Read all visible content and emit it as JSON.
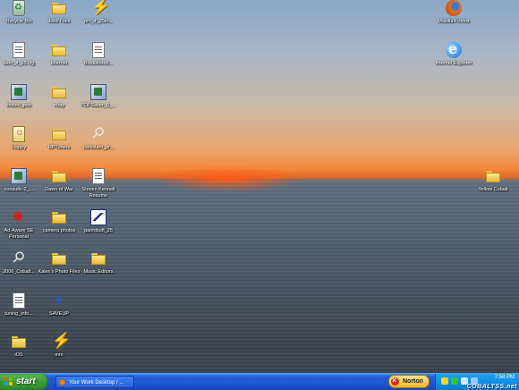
{
  "desktop": {
    "icons": [
      {
        "name": "recycle-bin-icon",
        "glyph": "bin",
        "label": "Recycle Bin",
        "col": 0,
        "row": 0
      },
      {
        "name": "folder-icon",
        "glyph": "folder",
        "label": "Jobs Files",
        "col": 1,
        "row": 0
      },
      {
        "name": "lightning-icon",
        "glyph": "bolt",
        "label": "pm_4_25in...",
        "col": 2,
        "row": 0
      },
      {
        "name": "document-icon",
        "glyph": "doc",
        "label": "dam_4_25.cfg",
        "col": 0,
        "row": 1
      },
      {
        "name": "folder-icon",
        "glyph": "folder",
        "label": "Internet",
        "col": 1,
        "row": 1
      },
      {
        "name": "document-icon",
        "glyph": "doc",
        "label": "Bookstore8...",
        "col": 2,
        "row": 1
      },
      {
        "name": "setup-icon",
        "glyph": "setup",
        "label": "limited_pos",
        "col": 0,
        "row": 2
      },
      {
        "name": "folder-icon",
        "glyph": "folder",
        "label": "ebay",
        "col": 1,
        "row": 2
      },
      {
        "name": "setup-icon",
        "glyph": "setup",
        "label": "PDFSaver_0_...",
        "col": 2,
        "row": 2
      },
      {
        "name": "happy-document-icon",
        "glyph": "happy",
        "label": "Happy",
        "col": 0,
        "row": 3
      },
      {
        "name": "folder-icon",
        "glyph": "folder",
        "label": "HPTuners",
        "col": 1,
        "row": 3
      },
      {
        "name": "wrench-icon",
        "glyph": "wrench2",
        "label": "darkslant_pr...",
        "col": 2,
        "row": 3
      },
      {
        "name": "setup-icon",
        "glyph": "setup",
        "label": "consultc-2_...",
        "col": 0,
        "row": 4
      },
      {
        "name": "folder-icon",
        "glyph": "folder",
        "label": "Dawn of War",
        "col": 1,
        "row": 4
      },
      {
        "name": "resume-document-icon",
        "glyph": "doc",
        "label": "Steven Kennell Resume",
        "col": 2,
        "row": 4
      },
      {
        "name": "ad-aware-icon",
        "glyph": "spider",
        "label": "Ad-Aware SE Personal",
        "col": 0,
        "row": 5
      },
      {
        "name": "folder-icon",
        "glyph": "folder",
        "label": "camera photos",
        "col": 1,
        "row": 5
      },
      {
        "name": "chart-icon",
        "glyph": "chart",
        "label": "panhlboft_25",
        "col": 2,
        "row": 5
      },
      {
        "name": "wrench-icon",
        "glyph": "wrench2",
        "label": "2006_Cobalt...",
        "col": 0,
        "row": 6
      },
      {
        "name": "folder-icon",
        "glyph": "folder",
        "label": "Kalen's Photo Files",
        "col": 1,
        "row": 6
      },
      {
        "name": "folder-icon",
        "glyph": "folder",
        "label": "Music Editors",
        "col": 2,
        "row": 6
      },
      {
        "name": "document-icon",
        "glyph": "doc",
        "label": "tuning_info...",
        "col": 0,
        "row": 7
      },
      {
        "name": "wizard-icon",
        "glyph": "wizard",
        "label": "SAVEUP",
        "col": 1,
        "row": 7
      },
      {
        "name": "folder-icon",
        "glyph": "folder",
        "label": "iOS",
        "col": 0,
        "row": 8
      },
      {
        "name": "lightning-icon",
        "glyph": "bolt",
        "label": "mm",
        "col": 1,
        "row": 8
      }
    ],
    "right_icons": [
      {
        "name": "firefox-icon",
        "glyph": "firefox",
        "label": "Mozilla Firefox",
        "slot": "ff"
      },
      {
        "name": "internet-explorer-icon",
        "glyph": "ie",
        "label": "Internet Explorer",
        "slot": "ie"
      },
      {
        "name": "folder-icon",
        "glyph": "folder",
        "label": "Yellow Cobalt",
        "slot": "yc"
      }
    ]
  },
  "taskbar": {
    "start_label": "start",
    "task_button_label": "Your Work Desktop / ...",
    "norton_label": "Norton",
    "clock": "7:58 PM",
    "watermark": "COBALTSS.net"
  },
  "colors": {
    "taskbar": "#245edb",
    "start_button": "#3a9a34",
    "tray": "#128fe2"
  }
}
